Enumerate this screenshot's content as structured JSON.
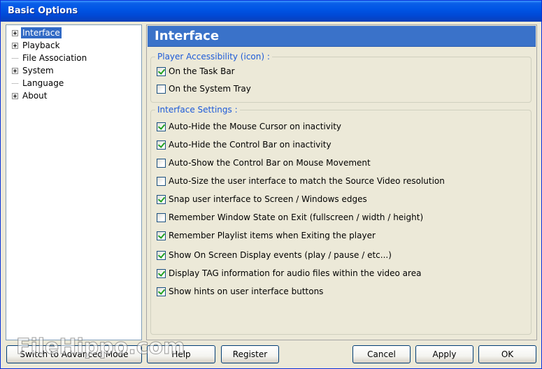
{
  "window": {
    "title": "Basic Options"
  },
  "tree": {
    "items": [
      {
        "label": "Interface",
        "expandable": true,
        "selected": true
      },
      {
        "label": "Playback",
        "expandable": true,
        "selected": false
      },
      {
        "label": "File Association",
        "expandable": false,
        "selected": false
      },
      {
        "label": "System",
        "expandable": true,
        "selected": false
      },
      {
        "label": "Language",
        "expandable": false,
        "selected": false
      },
      {
        "label": "About",
        "expandable": true,
        "selected": false
      }
    ]
  },
  "panel": {
    "title": "Interface",
    "accessibility": {
      "legend": "Player Accessibility (icon) :",
      "options": [
        {
          "label": "On the Task Bar",
          "checked": true
        },
        {
          "label": "On the System Tray",
          "checked": false
        }
      ]
    },
    "settings": {
      "legend": "Interface Settings :",
      "options": [
        {
          "label": "Auto-Hide the Mouse Cursor on inactivity",
          "checked": true
        },
        {
          "label": "Auto-Hide the Control Bar on inactivity",
          "checked": true
        },
        {
          "label": "Auto-Show the Control Bar on Mouse Movement",
          "checked": false
        },
        {
          "label": "Auto-Size the user interface to match the Source Video resolution",
          "checked": false
        },
        {
          "label": "Snap user interface to Screen / Windows edges",
          "checked": true
        },
        {
          "label": "Remember Window State on Exit (fullscreen / width / height)",
          "checked": false
        },
        {
          "label": "Remember Playlist items when Exiting the player",
          "checked": true
        },
        {
          "label": "Show On Screen Display events (play / pause / etc...)",
          "checked": true
        },
        {
          "label": "Display TAG information for audio files within the video area",
          "checked": true
        },
        {
          "label": "Show hints on user interface buttons",
          "checked": true
        }
      ]
    }
  },
  "buttons": {
    "advanced": "Switch to Advanced Mode",
    "help": "Help",
    "register": "Register",
    "cancel": "Cancel",
    "apply": "Apply",
    "ok": "OK"
  },
  "watermark": "FileHippo.com"
}
